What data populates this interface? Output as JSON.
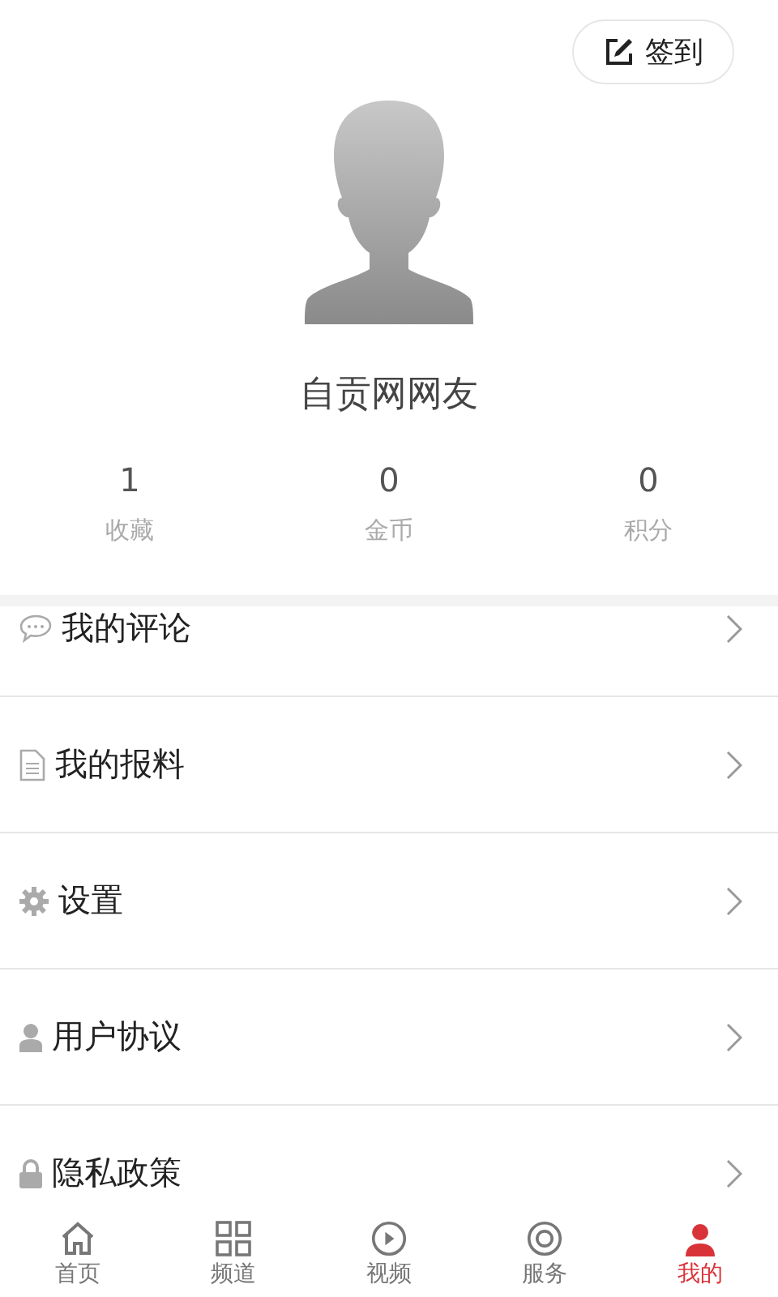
{
  "checkin_button": {
    "label": "签到"
  },
  "profile": {
    "name": "自贡网网友"
  },
  "stats": [
    {
      "value": "1",
      "label": "收藏"
    },
    {
      "value": "0",
      "label": "金币"
    },
    {
      "value": "0",
      "label": "积分"
    }
  ],
  "menu": [
    {
      "kind": "comment",
      "label": "我的评论"
    },
    {
      "kind": "document",
      "label": "我的报料"
    },
    {
      "kind": "settings",
      "label": "设置"
    },
    {
      "kind": "user",
      "label": "用户协议"
    },
    {
      "kind": "lock",
      "label": "隐私政策"
    }
  ],
  "tabs": [
    {
      "kind": "home",
      "label": "首页",
      "selected": false
    },
    {
      "kind": "grid",
      "label": "频道",
      "selected": false
    },
    {
      "kind": "play",
      "label": "视频",
      "selected": false
    },
    {
      "kind": "service",
      "label": "服务",
      "selected": false
    },
    {
      "kind": "me",
      "label": "我的",
      "selected": true
    }
  ]
}
